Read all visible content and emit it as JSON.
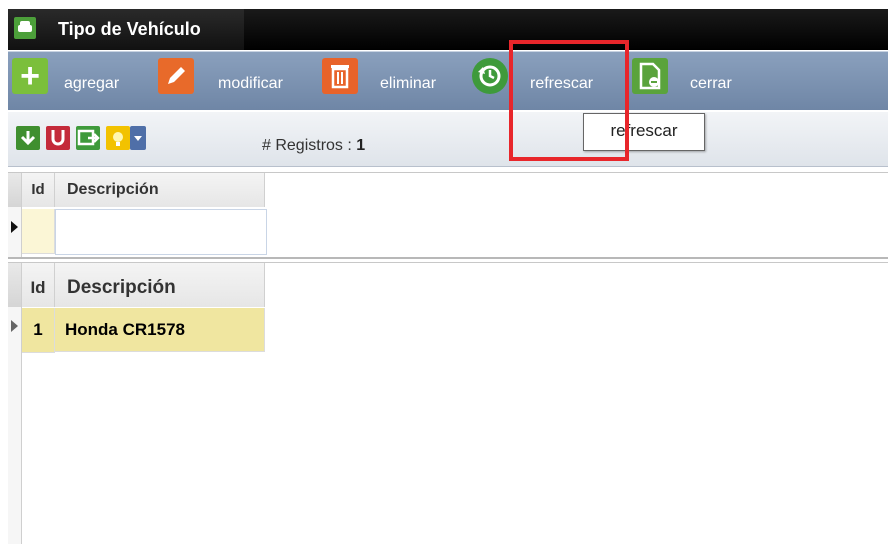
{
  "window": {
    "title": "Tipo de Vehículo"
  },
  "toolbar": {
    "add_label": "agregar",
    "edit_label": "modificar",
    "delete_label": "eliminar",
    "refresh_label": "refrescar",
    "close_label": "cerrar"
  },
  "subbar": {
    "records_label": "# Registros :",
    "records_count": "1"
  },
  "tooltip": {
    "text": "refrescar"
  },
  "grid_top": {
    "headers": {
      "id": "Id",
      "desc": "Descripción"
    },
    "rows": [
      {
        "id": "",
        "desc": ""
      }
    ]
  },
  "grid_bottom": {
    "headers": {
      "id": "Id",
      "desc": "Descripción"
    },
    "rows": [
      {
        "id": "1",
        "desc": "Honda CR1578"
      }
    ]
  },
  "colors": {
    "toolbar": "#7a91b1",
    "highlight": "#e8262b",
    "selected_row": "#f0e6a0",
    "new_row": "#fbf6d6"
  }
}
